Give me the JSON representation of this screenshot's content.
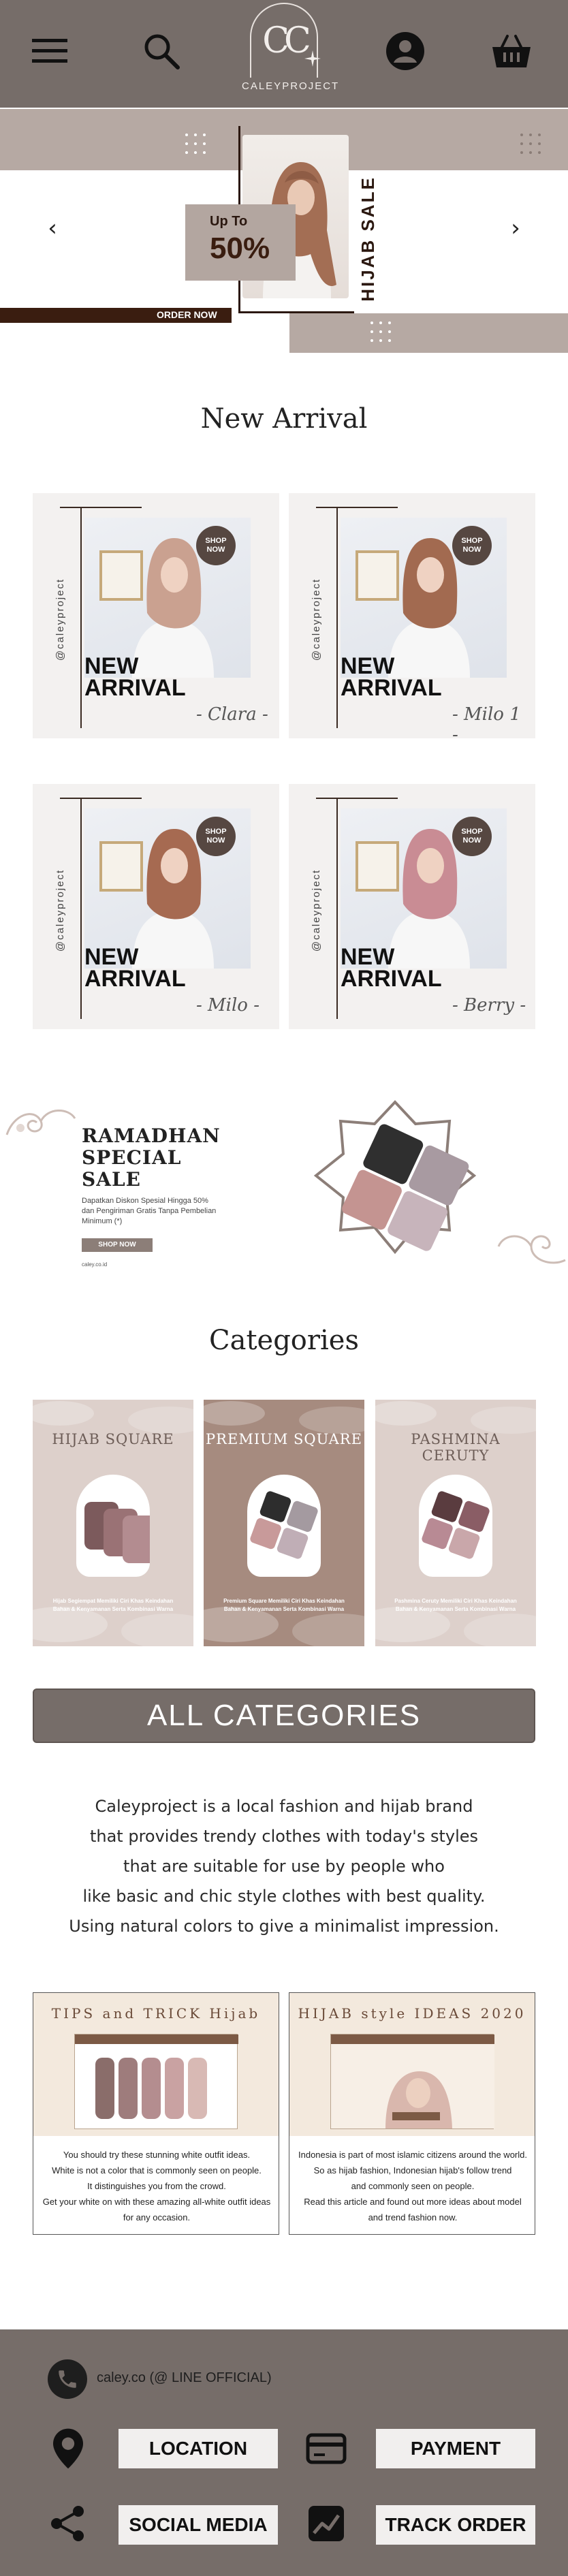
{
  "header": {
    "logo_letters": "CC",
    "logo_text": "CALEYPROJECT",
    "icons": [
      "menu-icon",
      "search-icon",
      "user-icon",
      "basket-icon"
    ]
  },
  "hero": {
    "up_to": "Up To",
    "percent": "50%",
    "vertical_text": "HIJAB SALE",
    "order_now": "ORDER NOW",
    "prev_arrow": "‹",
    "next_arrow": "›"
  },
  "new_arrival": {
    "title": "New Arrival",
    "cards": [
      {
        "side": "@caleyproject",
        "badge_line1": "SHOP",
        "badge_line2": "NOW",
        "line1": "NEW",
        "line2": "ARRIVAL",
        "name": "- Clara -",
        "scarf": "#caa190"
      },
      {
        "side": "@caleyproject",
        "badge_line1": "SHOP",
        "badge_line2": "NOW",
        "line1": "NEW",
        "line2": "ARRIVAL",
        "name": "- Milo 1 -",
        "scarf": "#a26a50"
      },
      {
        "side": "@caleyproject",
        "badge_line1": "SHOP",
        "badge_line2": "NOW",
        "line1": "NEW",
        "line2": "ARRIVAL",
        "name": "- Milo -",
        "scarf": "#a66a51"
      },
      {
        "side": "@caleyproject",
        "badge_line1": "SHOP",
        "badge_line2": "NOW",
        "line1": "NEW",
        "line2": "ARRIVAL",
        "name": "- Berry -",
        "scarf": "#c98c94"
      }
    ]
  },
  "ramadhan": {
    "title_l1": "RAMADHAN",
    "title_l2": "SPECIAL",
    "title_l3": "SALE",
    "subtitle": "Dapatkan Diskon Spesial Hingga 50% dan Pengiriman Gratis Tanpa Pembelian Minimum (*)",
    "button": "SHOP NOW",
    "site": "caley.co.id"
  },
  "categories": {
    "title": "Categories",
    "items": [
      {
        "name": "HIJAB SQUARE",
        "desc": "Hijab Segiempat Memiliki Ciri Khas Keindahan Bahan & Kenyamanan Serta Kombinasi Warna",
        "bg": "#ddd0cb",
        "title_color": "#6d5d57",
        "swatches": [
          "#7c5a5c",
          "#9a7275",
          "#b38c90"
        ]
      },
      {
        "name": "PREMIUM SQUARE",
        "desc": "Premium Square Memiliki Ciri Khas Keindahan Bahan & Kenyamanan Serta Kombinasi Warna",
        "bg": "#a68b7f",
        "title_color": "#ffffff",
        "swatches": [
          "#2d2d2d",
          "#a49aa0",
          "#c89a9a",
          "#c0aeb6"
        ]
      },
      {
        "name": "PASHMINA CERUTY",
        "desc": "Pashmina Ceruty Memiliki Ciri Khas Keindahan Bahan & Kenyamanan Serta Kombinasi Warna",
        "bg": "#ddd0cb",
        "title_color": "#6d5d57",
        "swatches": [
          "#5a3c3f",
          "#8a5d65",
          "#b88a94",
          "#c9a7aa"
        ]
      }
    ],
    "all_label": "ALL CATEGORIES"
  },
  "about": {
    "lines": [
      "Caleyproject is a local fashion and hijab brand",
      "that provides trendy clothes with today's styles",
      "that are suitable for use by people who",
      "like basic and chic style clothes with best quality.",
      "Using natural colors to give a minimalist impression."
    ]
  },
  "articles": [
    {
      "thumb_title": "TIPS and TRICK Hijab",
      "lines": [
        "You should try these stunning white outfit ideas.",
        "White is not a color that is commonly seen on people.",
        "It distinguishes you from the crowd.",
        "Get your white on with these amazing all-white outfit ideas",
        "for any occasion."
      ]
    },
    {
      "thumb_title": "HIJAB style IDEAS 2020",
      "lines": [
        "Indonesia is part of most islamic citizens around the world.",
        "So as hijab fashion, Indonesian hijab's follow trend",
        "and commonly seen on people.",
        "Read this article and found out more ideas about model",
        "and trend fashion now."
      ]
    }
  ],
  "footer": {
    "phone": "caley.co (@ LINE OFFICIAL)",
    "location": "LOCATION",
    "payment": "PAYMENT",
    "social": "SOCIAL MEDIA",
    "track": "TRACK ORDER"
  }
}
